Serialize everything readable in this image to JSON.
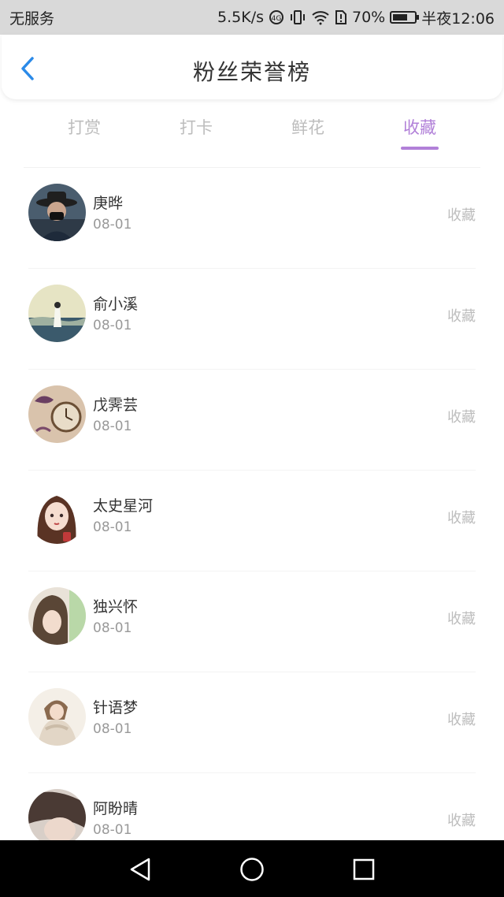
{
  "status_bar": {
    "carrier": "无服务",
    "speed": "5.5K/s",
    "battery": "70%",
    "battery_level": 0.7,
    "time": "半夜12:06"
  },
  "header": {
    "title": "粉丝荣誉榜",
    "back_icon": "chevron-left-icon"
  },
  "tabs": [
    {
      "label": "打赏",
      "active": false
    },
    {
      "label": "打卡",
      "active": false
    },
    {
      "label": "鲜花",
      "active": false
    },
    {
      "label": "收藏",
      "active": true
    }
  ],
  "colors": {
    "accent": "#b180d8",
    "back": "#2b8ae8",
    "muted": "#bdbdbd"
  },
  "fans": [
    {
      "name": "庚晔",
      "date": "08-01",
      "action": "收藏"
    },
    {
      "name": "俞小溪",
      "date": "08-01",
      "action": "收藏"
    },
    {
      "name": "戊霁芸",
      "date": "08-01",
      "action": "收藏"
    },
    {
      "name": "太史星河",
      "date": "08-01",
      "action": "收藏"
    },
    {
      "name": "独兴怀",
      "date": "08-01",
      "action": "收藏"
    },
    {
      "name": "针语梦",
      "date": "08-01",
      "action": "收藏"
    },
    {
      "name": "阿盼晴",
      "date": "08-01",
      "action": "收藏"
    }
  ],
  "nav": {
    "back_icon": "triangle-back-icon",
    "home_icon": "circle-home-icon",
    "recent_icon": "square-recent-icon"
  }
}
